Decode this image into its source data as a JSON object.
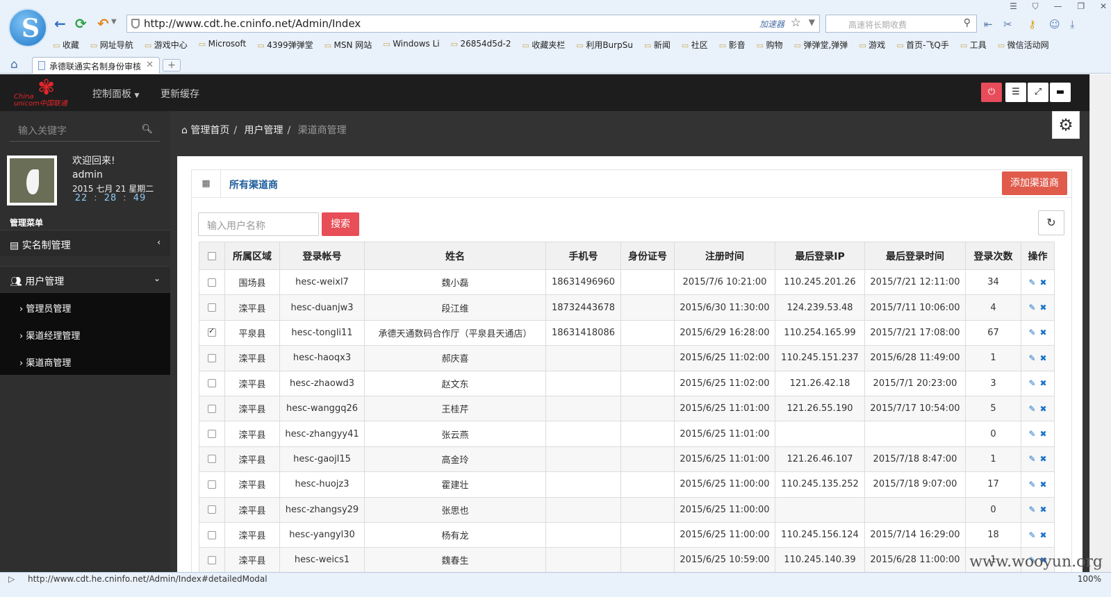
{
  "browser": {
    "url": "http://www.cdt.he.cninfo.net/Admin/Index",
    "accelerator": "加速器",
    "search_placeholder": "高速将长期收费",
    "bookmarks": [
      "收藏",
      "网址导航",
      "游戏中心",
      "Microsoft",
      "4399弹弹堂",
      "MSN 网站",
      "Windows Li",
      "26854d5d-2",
      "收藏夹栏",
      "利用BurpSu",
      "新闻",
      "社区",
      "影音",
      "购物",
      "弹弹堂,弹弹",
      "游戏",
      "首页-飞Q手",
      "工具",
      "微信活动网"
    ],
    "tab_title": "承德联通实名制身份审核",
    "status_url": "http://www.cdt.he.cninfo.net/Admin/Index#detailedModal",
    "zoom": "100%",
    "watermark": "www.wooyun.org"
  },
  "header": {
    "menu_dashboard": "控制面板",
    "menu_cache": "更新缓存"
  },
  "sidebar": {
    "search_placeholder": "输入关键字",
    "welcome": "欢迎回来!",
    "username": "admin",
    "date": "2015 七月 21 星期二",
    "clock": {
      "h": "22",
      "m": "28",
      "s": "49"
    },
    "menu_title": "管理菜单",
    "items": [
      {
        "label": "实名制管理"
      },
      {
        "label": "用户管理"
      }
    ],
    "subitems": [
      "管理员管理",
      "渠道经理管理",
      "渠道商管理"
    ]
  },
  "breadcrumb": [
    "管理首页",
    "用户管理",
    "渠道商管理"
  ],
  "panel": {
    "title": "所有渠道商",
    "add_button": "添加渠道商",
    "user_input_placeholder": "输入用户名称",
    "search_button": "搜索"
  },
  "table": {
    "headers": [
      "所属区域",
      "登录帐号",
      "姓名",
      "手机号",
      "身份证号",
      "注册时间",
      "最后登录IP",
      "最后登录时间",
      "登录次数",
      "操作"
    ],
    "rows": [
      {
        "checked": false,
        "cells": [
          "围场县",
          "hesc-weixl7",
          "魏小磊",
          "18631496960",
          "",
          "2015/7/6 10:21:00",
          "110.245.201.26",
          "2015/7/21 12:11:00",
          "34"
        ]
      },
      {
        "checked": false,
        "cells": [
          "滦平县",
          "hesc-duanjw3",
          "段江维",
          "18732443678",
          "",
          "2015/6/30 11:30:00",
          "124.239.53.48",
          "2015/7/11 10:06:00",
          "4"
        ]
      },
      {
        "checked": true,
        "cells": [
          "平泉县",
          "hesc-tongli11",
          "承德天通数码合作厅（平泉县天通店）",
          "18631418086",
          "",
          "2015/6/29 16:28:00",
          "110.254.165.99",
          "2015/7/21 17:08:00",
          "67"
        ]
      },
      {
        "checked": false,
        "cells": [
          "滦平县",
          "hesc-haoqx3",
          "郝庆喜",
          "",
          "",
          "2015/6/25 11:02:00",
          "110.245.151.237",
          "2015/6/28 11:49:00",
          "1"
        ]
      },
      {
        "checked": false,
        "cells": [
          "滦平县",
          "hesc-zhaowd3",
          "赵文东",
          "",
          "",
          "2015/6/25 11:02:00",
          "121.26.42.18",
          "2015/7/1 20:23:00",
          "3"
        ]
      },
      {
        "checked": false,
        "cells": [
          "滦平县",
          "hesc-wanggq26",
          "王桂芹",
          "",
          "",
          "2015/6/25 11:01:00",
          "121.26.55.190",
          "2015/7/17 10:54:00",
          "5"
        ]
      },
      {
        "checked": false,
        "cells": [
          "滦平县",
          "hesc-zhangyy41",
          "张云燕",
          "",
          "",
          "2015/6/25 11:01:00",
          "",
          "",
          "0"
        ]
      },
      {
        "checked": false,
        "cells": [
          "滦平县",
          "hesc-gaojl15",
          "高金玲",
          "",
          "",
          "2015/6/25 11:01:00",
          "121.26.46.107",
          "2015/7/18 8:47:00",
          "1"
        ]
      },
      {
        "checked": false,
        "cells": [
          "滦平县",
          "hesc-huojz3",
          "霍建壮",
          "",
          "",
          "2015/6/25 11:00:00",
          "110.245.135.252",
          "2015/7/18 9:07:00",
          "17"
        ]
      },
      {
        "checked": false,
        "cells": [
          "滦平县",
          "hesc-zhangsy29",
          "张思也",
          "",
          "",
          "2015/6/25 11:00:00",
          "",
          "",
          "0"
        ]
      },
      {
        "checked": false,
        "cells": [
          "滦平县",
          "hesc-yangyl30",
          "杨有龙",
          "",
          "",
          "2015/6/25 11:00:00",
          "110.245.156.124",
          "2015/7/14 16:29:00",
          "18"
        ]
      },
      {
        "checked": false,
        "cells": [
          "滦平县",
          "hesc-weics1",
          "魏春生",
          "",
          "",
          "2015/6/25 10:59:00",
          "110.245.140.39",
          "2015/6/28 11:00:00",
          "1"
        ]
      }
    ]
  },
  "colors": {
    "accent": "#e05b4c",
    "header_bg": "#1d1d1d",
    "sidebar_bg": "#2f2f2f",
    "link": "#1b5b9a"
  }
}
